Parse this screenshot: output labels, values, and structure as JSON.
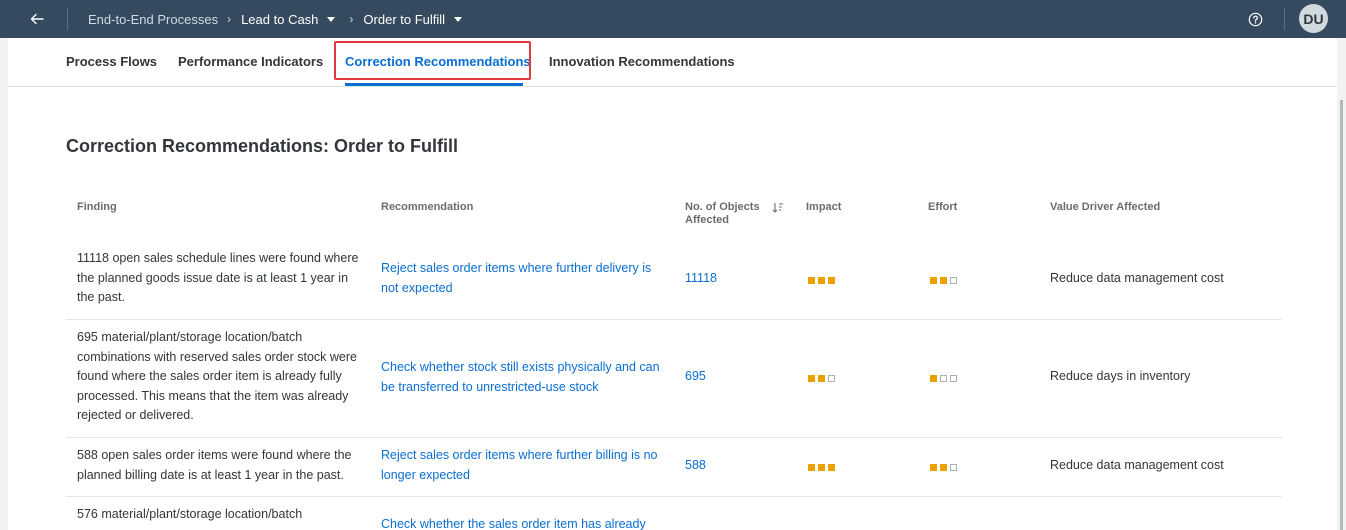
{
  "shell": {
    "breadcrumb_root": "End-to-End Processes",
    "breadcrumb_level1": "Lead to Cash",
    "breadcrumb_level2": "Order to Fulfill",
    "avatar_initials": "DU"
  },
  "tabs": [
    {
      "label": "Process Flows"
    },
    {
      "label": "Performance Indicators"
    },
    {
      "label": "Correction Recommendations"
    },
    {
      "label": "Innovation Recommendations"
    }
  ],
  "active_tab": "Correction Recommendations",
  "section_title": "Correction Recommendations: Order to Fulfill",
  "table": {
    "columns": [
      "Finding",
      "Recommendation",
      "No. of Objects Affected",
      "Impact",
      "Effort",
      "Value Driver Affected"
    ],
    "rows": [
      {
        "finding": "11118 open sales schedule lines were found where the planned goods issue date is at least 1 year in the past.",
        "recommendation": "Reject sales order items where further delivery is not expected",
        "objects": "11118",
        "impact": 3,
        "effort": 2,
        "value_driver": "Reduce data management cost"
      },
      {
        "finding": "695 material/plant/storage location/batch combinations with reserved sales order stock were found where the sales order item is already fully processed. This means that the item was already rejected or delivered.",
        "recommendation": "Check whether stock still exists physically and can be transferred to unrestricted-use stock",
        "objects": "695",
        "impact": 2,
        "effort": 1,
        "value_driver": "Reduce days in inventory"
      },
      {
        "finding": "588 open sales order items were found where the planned billing date is at least 1 year in the past.",
        "recommendation": "Reject sales order items where further billing is no longer expected",
        "objects": "588",
        "impact": 3,
        "effort": 2,
        "value_driver": "Reduce data management cost"
      },
      {
        "finding": "576 material/plant/storage location/batch",
        "recommendation": "Check whether the sales order item has already",
        "objects": "",
        "impact": 0,
        "effort": 0,
        "value_driver": ""
      }
    ]
  },
  "colors": {
    "shell_bg": "#354a5f",
    "link": "#0a6ed1",
    "rating_filled": "#e9a200",
    "highlight_box": "#e0393e"
  }
}
